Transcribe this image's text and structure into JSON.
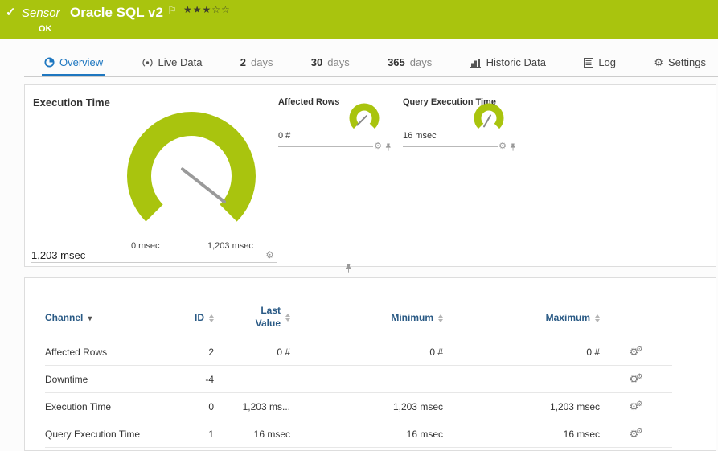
{
  "colors": {
    "brand_green": "#a9c40e",
    "accent_blue": "#1e77c0",
    "gauge_green": "#a9c40e"
  },
  "icons": {
    "check": "✓",
    "flag": "⚐",
    "gear": "⚙",
    "caret_down": "▾",
    "stars_filled": "★★★",
    "stars_empty": "☆☆"
  },
  "header": {
    "type_label": "Sensor",
    "name": "Oracle SQL v2",
    "status": "OK",
    "priority_filled": 3,
    "priority_total": 5
  },
  "tabs": [
    {
      "label": "Overview",
      "active": true
    },
    {
      "label": "Live Data"
    },
    {
      "number": "2",
      "unit": "days"
    },
    {
      "number": "30",
      "unit": "days"
    },
    {
      "number": "365",
      "unit": "days"
    },
    {
      "label": "Historic Data"
    },
    {
      "label": "Log"
    },
    {
      "label": "Settings"
    }
  ],
  "gauges": {
    "execution_time": {
      "title": "Execution Time",
      "value": "1,203 msec",
      "scale_min": "0 msec",
      "scale_max": "1,203 msec"
    },
    "affected_rows": {
      "title": "Affected Rows",
      "value": "0 #"
    },
    "query_execution_time": {
      "title": "Query Execution Time",
      "value": "16 msec"
    }
  },
  "table": {
    "headers": {
      "channel": "Channel",
      "id": "ID",
      "last_value": "Last Value",
      "minimum": "Minimum",
      "maximum": "Maximum"
    },
    "rows": [
      {
        "channel": "Affected Rows",
        "id": "2",
        "last_value": "0 #",
        "minimum": "0 #",
        "maximum": "0 #"
      },
      {
        "channel": "Downtime",
        "id": "-4",
        "last_value": "",
        "minimum": "",
        "maximum": ""
      },
      {
        "channel": "Execution Time",
        "id": "0",
        "last_value": "1,203 ms...",
        "minimum": "1,203 msec",
        "maximum": "1,203 msec"
      },
      {
        "channel": "Query Execution Time",
        "id": "1",
        "last_value": "16 msec",
        "minimum": "16 msec",
        "maximum": "16 msec"
      }
    ]
  }
}
